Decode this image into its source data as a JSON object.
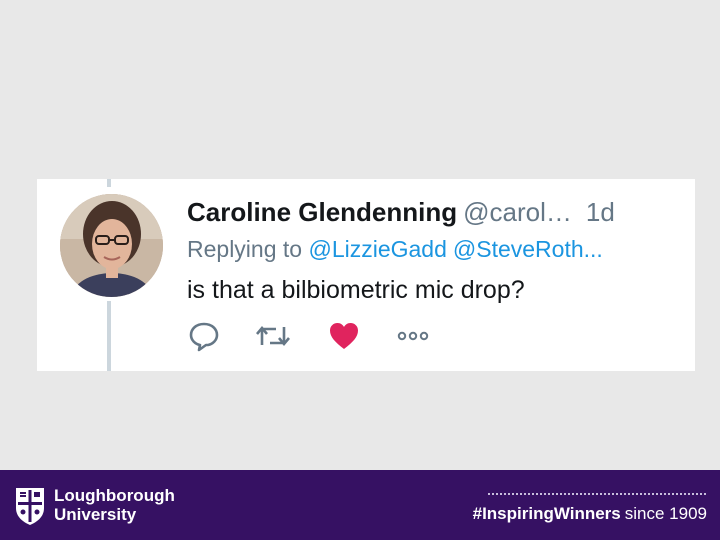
{
  "tweet": {
    "author_name": "Caroline Glendenning",
    "author_handle": "@carol…",
    "timestamp": "1d",
    "replying_prefix": "Replying to",
    "replying_to": [
      "@LizzieGadd",
      "@SteveRoth..."
    ],
    "text": "is that a bilbiometric mic drop?",
    "liked": true,
    "icons": {
      "reply": "reply-icon",
      "retweet": "retweet-icon",
      "like": "heart-icon",
      "more": "more-icon"
    },
    "colors": {
      "name": "#14171a",
      "secondary": "#657786",
      "mention": "#1b95e0",
      "like": "#e0245e",
      "icon": "#657786"
    }
  },
  "footer": {
    "logo_line1": "Loughborough",
    "logo_line2": "University",
    "hashtag": "#InspiringWinners",
    "since": "since 1909",
    "colors": {
      "background": "#361163",
      "text": "#ffffff"
    }
  },
  "background_color": "#e8e8e8"
}
